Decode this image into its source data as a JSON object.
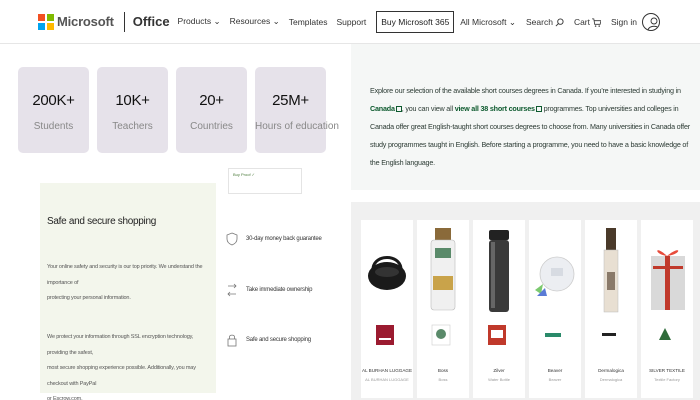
{
  "header": {
    "brand": "Microsoft",
    "product": "Office",
    "nav": [
      "Products",
      "Resources",
      "Templates",
      "Support"
    ],
    "buy_label": "Buy Microsoft 365",
    "all_microsoft": "All Microsoft",
    "search": "Search",
    "cart": "Cart",
    "sign_in": "Sign in"
  },
  "stats": [
    {
      "value": "200K+",
      "label": "Students"
    },
    {
      "value": "10K+",
      "label": "Teachers"
    },
    {
      "value": "20+",
      "label": "Countries"
    },
    {
      "value": "25M+",
      "label": "Hours of education"
    }
  ],
  "tiny_card": "Buy Proof ✓",
  "secure": {
    "title": "Safe and secure shopping",
    "p1": [
      "Your online safety and security is our top priority. We understand the importance of",
      "protecting your personal information."
    ],
    "p2": [
      "We protect your information through SSL encryption technology, providing the safest,",
      "most secure shopping experience possible. Additionally, you may checkout with PayPal",
      "or Escrow.com."
    ]
  },
  "guarantees": [
    {
      "icon": "shield-icon",
      "label": "30-day money back guarantee"
    },
    {
      "icon": "transfer-icon",
      "label": "Take immediate ownership"
    },
    {
      "icon": "lock-icon",
      "label": "Safe and secure shopping"
    }
  ],
  "description": {
    "t1": "Explore our selection of the available short courses degrees in Canada. If you're interested in studying in ",
    "link1": "Canada",
    "t2": ", you can view all ",
    "link2": "view all 38 short courses",
    "t3": " programmes. Top universities and colleges in Canada offer great English-taught short courses degrees to choose from. Many universities in Canada offer study programmes taught in English. Before starting a programme, you need to have a basic knowledge of the English language."
  },
  "products": [
    {
      "name": "AL BURHAN LUGGAGE",
      "category": "AL BURHAN LUGGAGE",
      "icon": "bag-icon"
    },
    {
      "name": "Boss",
      "category": "Boss",
      "icon": "bottle-icon"
    },
    {
      "name": "Zilver",
      "category": "Water Bottle",
      "icon": "flask-icon"
    },
    {
      "name": "Beaver",
      "category": "Beaver",
      "icon": "scale-icon"
    },
    {
      "name": "Dermalogica",
      "category": "Dermalogica",
      "icon": "serum-icon"
    },
    {
      "name": "SILVER TEXTILE",
      "category": "Textile Factory",
      "icon": "gift-icon"
    }
  ],
  "colors": {
    "stat_bg": "#e6e2ea",
    "secure_bg": "#f3f6ec",
    "link": "#0d5a2e"
  }
}
